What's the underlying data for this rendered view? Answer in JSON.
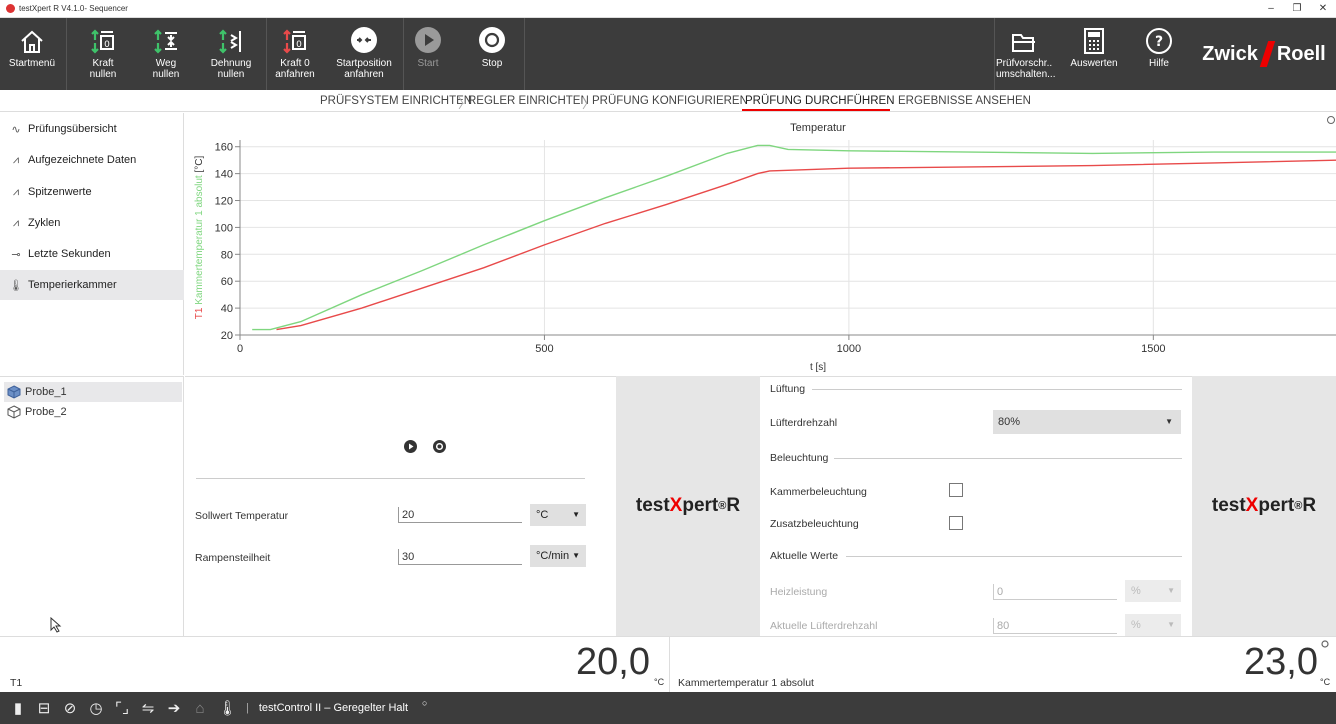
{
  "window": {
    "title": "testXpert R V4.1.0- Sequencer",
    "minimize": "–",
    "maximize": "❐",
    "close": "✕"
  },
  "toolbar": {
    "home": "Startmenü",
    "force_zero": [
      "Kraft",
      "nullen"
    ],
    "travel_zero": [
      "Weg",
      "nullen"
    ],
    "strain_zero": [
      "Dehnung",
      "nullen"
    ],
    "force0_approach": [
      "Kraft 0",
      "anfahren"
    ],
    "startpos_approach": [
      "Startposition",
      "anfahren"
    ],
    "start": "Start",
    "stop": "Stop",
    "switch_spec": [
      "Prüfvorschr..",
      "umschalten..."
    ],
    "evaluate": "Auswerten",
    "help": "Hilfe"
  },
  "brand": {
    "left": "Zwick",
    "right": "Roell"
  },
  "breadcrumb": [
    "PRÜFSYSTEM EINRICHTEN",
    "REGLER EINRICHTEN",
    "PRÜFUNG KONFIGURIEREN",
    "PRÜFUNG DURCHFÜHREN",
    "ERGEBNISSE ANSEHEN"
  ],
  "sidebar": {
    "items": [
      {
        "label": "Prüfungsübersicht",
        "icon": "∿"
      },
      {
        "label": "Aufgezeichnete Daten",
        "icon": "⩘"
      },
      {
        "label": "Spitzenwerte",
        "icon": "⩘"
      },
      {
        "label": "Zyklen",
        "icon": "⩘"
      },
      {
        "label": "Letzte Sekunden",
        "icon": "⊸"
      },
      {
        "label": "Temperierkammer",
        "icon": "🌡"
      }
    ]
  },
  "probes": [
    "Probe_1",
    "Probe_2"
  ],
  "chart_data": {
    "type": "line",
    "title": "Temperatur",
    "xlabel": "t [s]",
    "ylabel_parts": [
      "T1",
      "Kammertemperatur 1 absolut",
      "[°C]"
    ],
    "xlim": [
      0,
      1800
    ],
    "ylim": [
      20,
      165
    ],
    "xticks": [
      0,
      500,
      1000,
      1500
    ],
    "yticks": [
      20,
      40,
      60,
      80,
      100,
      120,
      140,
      160
    ],
    "grid": true,
    "series": [
      {
        "name": "Kammertemperatur 1 absolut",
        "color": "#7fd67f",
        "x": [
          20,
          50,
          100,
          200,
          300,
          400,
          500,
          600,
          700,
          800,
          850,
          870,
          900,
          1000,
          1200,
          1400,
          1600,
          1800
        ],
        "y": [
          24,
          24,
          30,
          50,
          68,
          87,
          105,
          122,
          138,
          155,
          161,
          161,
          158,
          157,
          156,
          155,
          156,
          156
        ]
      },
      {
        "name": "T1",
        "color": "#e84a4a",
        "x": [
          60,
          100,
          200,
          300,
          400,
          500,
          600,
          700,
          800,
          850,
          870,
          1000,
          1200,
          1400,
          1600,
          1800
        ],
        "y": [
          24,
          27,
          40,
          55,
          70,
          87,
          103,
          117,
          132,
          140,
          142,
          144,
          145,
          146,
          148,
          150
        ]
      }
    ]
  },
  "control": {
    "setpoint_label": "Sollwert Temperatur",
    "setpoint_value": "20",
    "setpoint_unit": "°C",
    "ramp_label": "Rampensteilheit",
    "ramp_value": "30",
    "ramp_unit": "°C/min"
  },
  "product_logo": {
    "pre": "test",
    "x": "X",
    "post": "pert",
    "reg": "®",
    "r": " R"
  },
  "settings": {
    "ventilation_title": "Lüftung",
    "fan_speed_label": "Lüfterdrehzahl",
    "fan_speed_value": "80%",
    "lighting_title": "Beleuchtung",
    "chamber_light_label": "Kammerbeleuchtung",
    "extra_light_label": "Zusatzbeleuchtung",
    "current_values_title": "Aktuelle Werte",
    "heating_label": "Heizleistung",
    "heating_value": "0",
    "heating_unit": "%",
    "current_fan_label": "Aktuelle Lüfterdrehzahl",
    "current_fan_value": "80",
    "current_fan_unit": "%"
  },
  "values": {
    "left_label": "T1",
    "left_value": "20,0",
    "left_unit": "°C",
    "right_label": "Kammertemperatur 1 absolut",
    "right_value": "23,0",
    "right_unit": "°C"
  },
  "status": {
    "text": "testControl II – Geregelter Halt"
  }
}
